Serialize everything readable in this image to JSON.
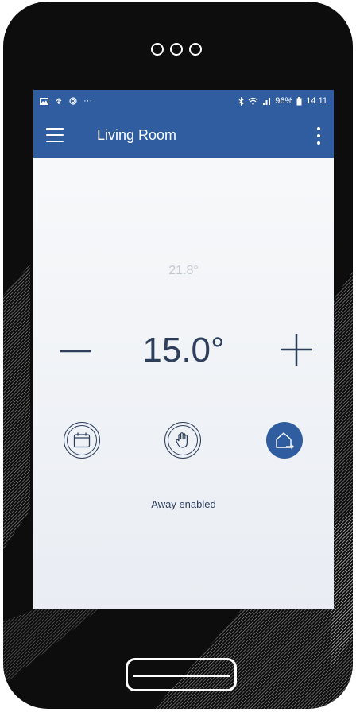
{
  "status_bar": {
    "time": "14:11",
    "battery": "96%",
    "notifications": "···"
  },
  "app_bar": {
    "title": "Living Room"
  },
  "thermostat": {
    "current_temp": "21.8°",
    "setpoint": "15.0°",
    "decrease_symbol": "—",
    "increase_symbol": "+"
  },
  "modes": [
    {
      "name": "schedule",
      "icon": "calendar-icon",
      "active": false
    },
    {
      "name": "manual",
      "icon": "hand-icon",
      "active": false
    },
    {
      "name": "away",
      "icon": "home-exit-icon",
      "active": true
    }
  ],
  "status_text": "Away enabled",
  "colors": {
    "primary": "#2f5d9f",
    "text_dark": "#2e3f5c",
    "text_muted": "#c2c7cf",
    "phone_body": "#0d0d0d"
  }
}
